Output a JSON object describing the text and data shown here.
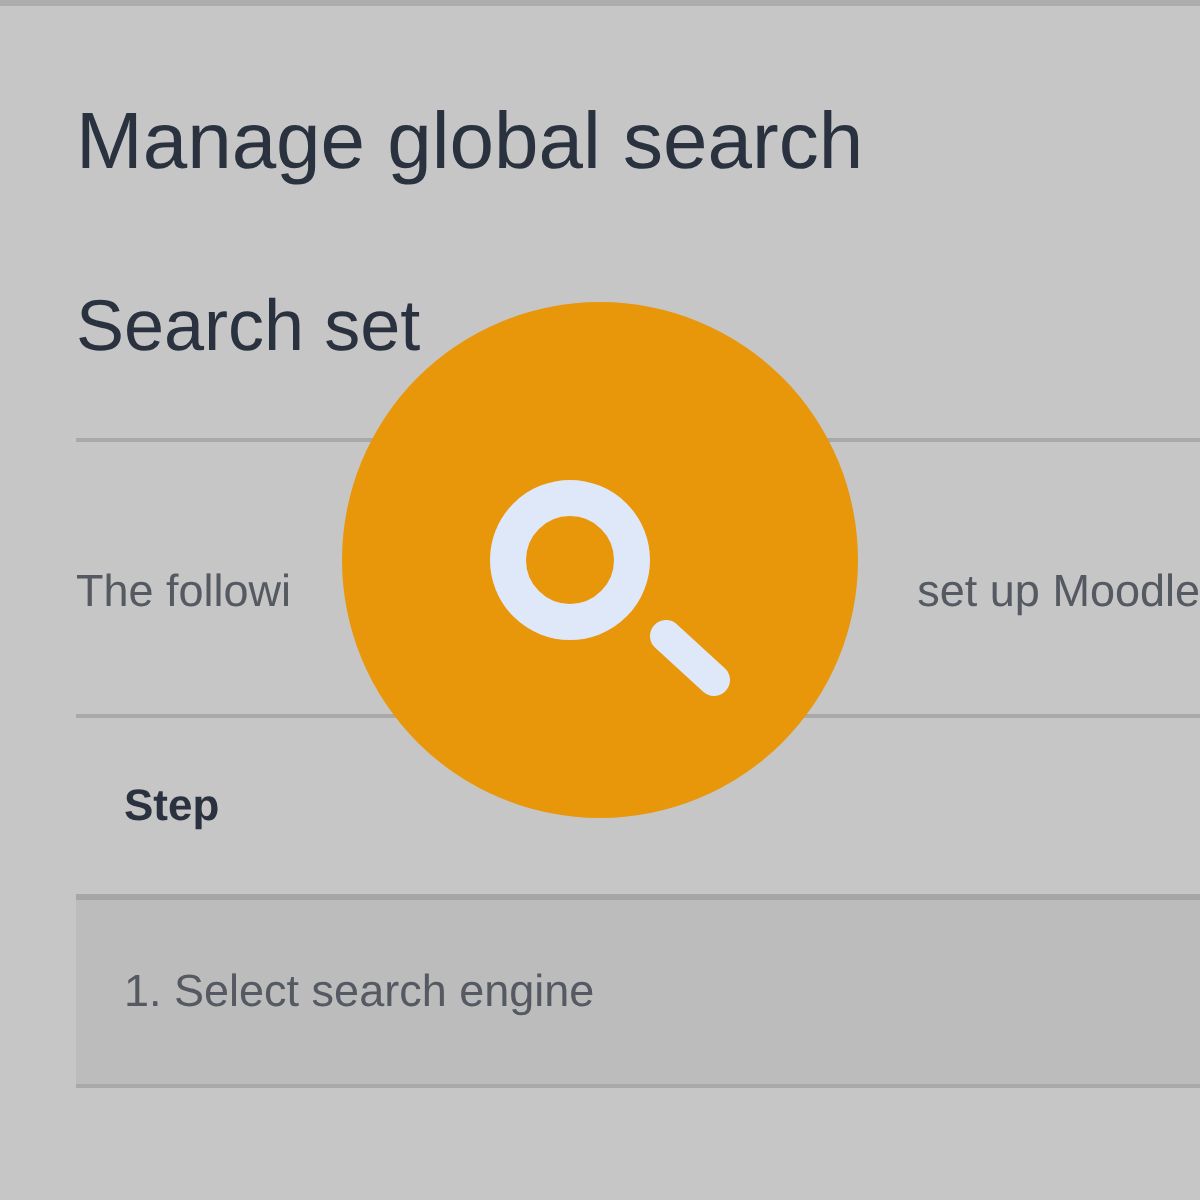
{
  "title": "Manage global search",
  "section": {
    "title": "Search set",
    "intro": [
      "The followi",
      "set up Moodle"
    ]
  },
  "table": {
    "columns": [
      "Step"
    ],
    "rows": [
      {
        "cells": [
          "1. Select search engine"
        ]
      }
    ]
  },
  "badge": {
    "kind": "search"
  }
}
